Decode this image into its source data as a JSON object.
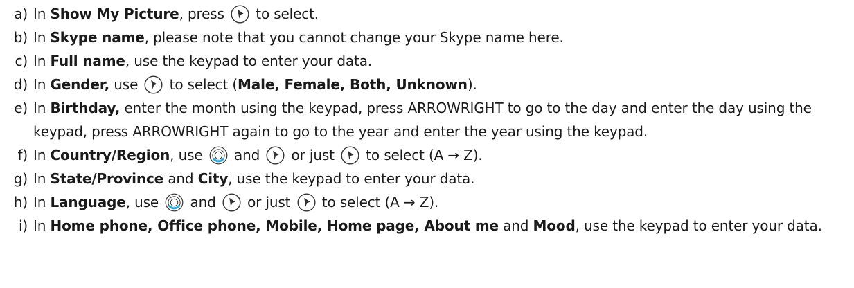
{
  "steps": [
    {
      "marker": "a)",
      "parts": [
        {
          "t": "In "
        },
        {
          "t": "Show My Picture",
          "b": true
        },
        {
          "t": ", press "
        },
        {
          "icon": "next-button-icon"
        },
        {
          "t": " to select."
        }
      ]
    },
    {
      "marker": "b)",
      "parts": [
        {
          "t": "In "
        },
        {
          "t": "Skype name",
          "b": true
        },
        {
          "t": ", please note that you cannot change your Skype name here."
        }
      ]
    },
    {
      "marker": "c)",
      "parts": [
        {
          "t": "In "
        },
        {
          "t": "Full name",
          "b": true
        },
        {
          "t": ", use the keypad to enter your data."
        }
      ]
    },
    {
      "marker": "d)",
      "parts": [
        {
          "t": "In "
        },
        {
          "t": "Gender,",
          "b": true
        },
        {
          "t": " use "
        },
        {
          "icon": "next-button-icon"
        },
        {
          "t": " to select ("
        },
        {
          "t": "Male, Female, Both, Unknown",
          "b": true
        },
        {
          "t": ")."
        }
      ]
    },
    {
      "marker": "e)",
      "parts": [
        {
          "t": "In "
        },
        {
          "t": "Birthday,",
          "b": true
        },
        {
          "t": " enter the month using the keypad, press ARROWRIGHT to go to the day and enter the day using the keypad, press ARROWRIGHT again to go to the year and enter the year using the keypad."
        }
      ]
    },
    {
      "marker": "f)",
      "parts": [
        {
          "t": "In "
        },
        {
          "t": "Country/Region",
          "b": true
        },
        {
          "t": ", use "
        },
        {
          "icon": "navigation-ring-icon"
        },
        {
          "t": " and "
        },
        {
          "icon": "next-button-icon"
        },
        {
          "t": " or just "
        },
        {
          "icon": "next-button-icon"
        },
        {
          "t": " to select (A → Z)."
        }
      ]
    },
    {
      "marker": "g)",
      "parts": [
        {
          "t": "In "
        },
        {
          "t": "State/Province",
          "b": true
        },
        {
          "t": " and "
        },
        {
          "t": "City",
          "b": true
        },
        {
          "t": ", use the keypad to enter your data."
        }
      ]
    },
    {
      "marker": "h)",
      "parts": [
        {
          "t": "In "
        },
        {
          "t": "Language",
          "b": true
        },
        {
          "t": ", use "
        },
        {
          "icon": "navigation-ring-icon"
        },
        {
          "t": " and "
        },
        {
          "icon": "next-button-icon"
        },
        {
          "t": " or just "
        },
        {
          "icon": "next-button-icon"
        },
        {
          "t": " to select (A → Z)."
        }
      ]
    },
    {
      "marker": "i)",
      "parts": [
        {
          "t": "In "
        },
        {
          "t": "Home phone, Office phone, Mobile, Home page, About me",
          "b": true
        },
        {
          "t": " and "
        },
        {
          "t": "Mood",
          "b": true
        },
        {
          "t": ", use the keypad to enter your data."
        }
      ]
    }
  ],
  "colors": {
    "text": "#1a1a1a",
    "icon_stroke": "#333333",
    "ring_accent": "#2aa8e0"
  }
}
